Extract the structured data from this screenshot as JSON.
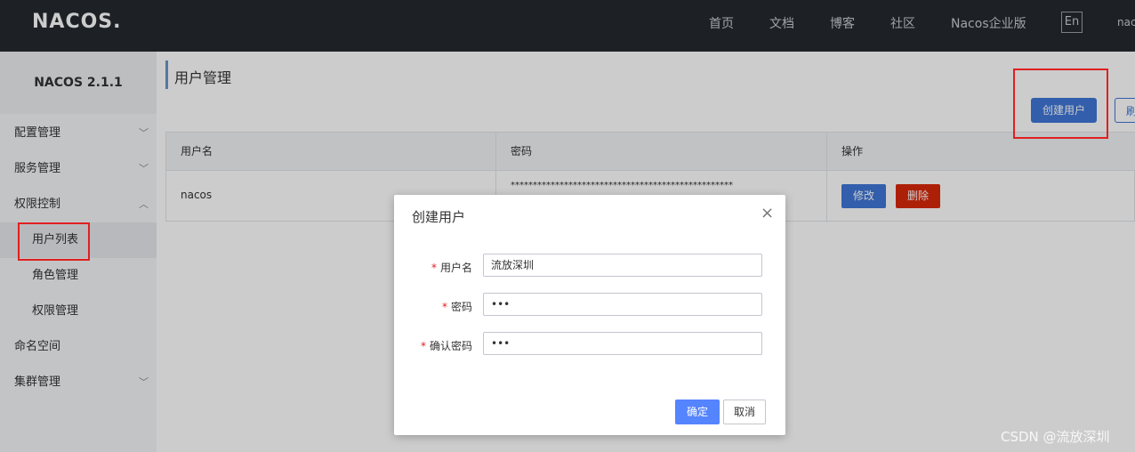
{
  "topbar": {
    "logo": "NACOS.",
    "nav": [
      "首页",
      "文档",
      "博客",
      "社区",
      "Nacos企业版"
    ],
    "lang": "En",
    "user": "nacos"
  },
  "sidebar": {
    "version": "NACOS 2.1.1",
    "items": [
      {
        "label": "配置管理",
        "icon": "chevron-down"
      },
      {
        "label": "服务管理",
        "icon": "chevron-down"
      },
      {
        "label": "权限控制",
        "icon": "chevron-up"
      },
      {
        "label": "用户列表"
      },
      {
        "label": "角色管理"
      },
      {
        "label": "权限管理"
      },
      {
        "label": "命名空间"
      },
      {
        "label": "集群管理",
        "icon": "chevron-down"
      }
    ]
  },
  "main": {
    "title": "用户管理",
    "create_button": "创建用户",
    "refresh_button": "刷新",
    "table": {
      "headers": [
        "用户名",
        "密码",
        "操作"
      ],
      "rows": [
        {
          "username": "nacos",
          "password": "**************************************************",
          "edit": "修改",
          "delete": "删除"
        }
      ]
    }
  },
  "dialog": {
    "title": "创建用户",
    "fields": [
      {
        "label": "用户名",
        "value": "流放深圳",
        "required": "*"
      },
      {
        "label": "密码",
        "value": "•••",
        "required": "*"
      },
      {
        "label": "确认密码",
        "value": "•••",
        "required": "*"
      }
    ],
    "ok": "确定",
    "cancel": "取消",
    "close_icon": "×"
  },
  "watermark": "CSDN @流放深圳",
  "colors": {
    "topbar": "#252a2f",
    "primary": "#3f76d8",
    "danger": "#d9280b",
    "highlight": "#e02020"
  }
}
